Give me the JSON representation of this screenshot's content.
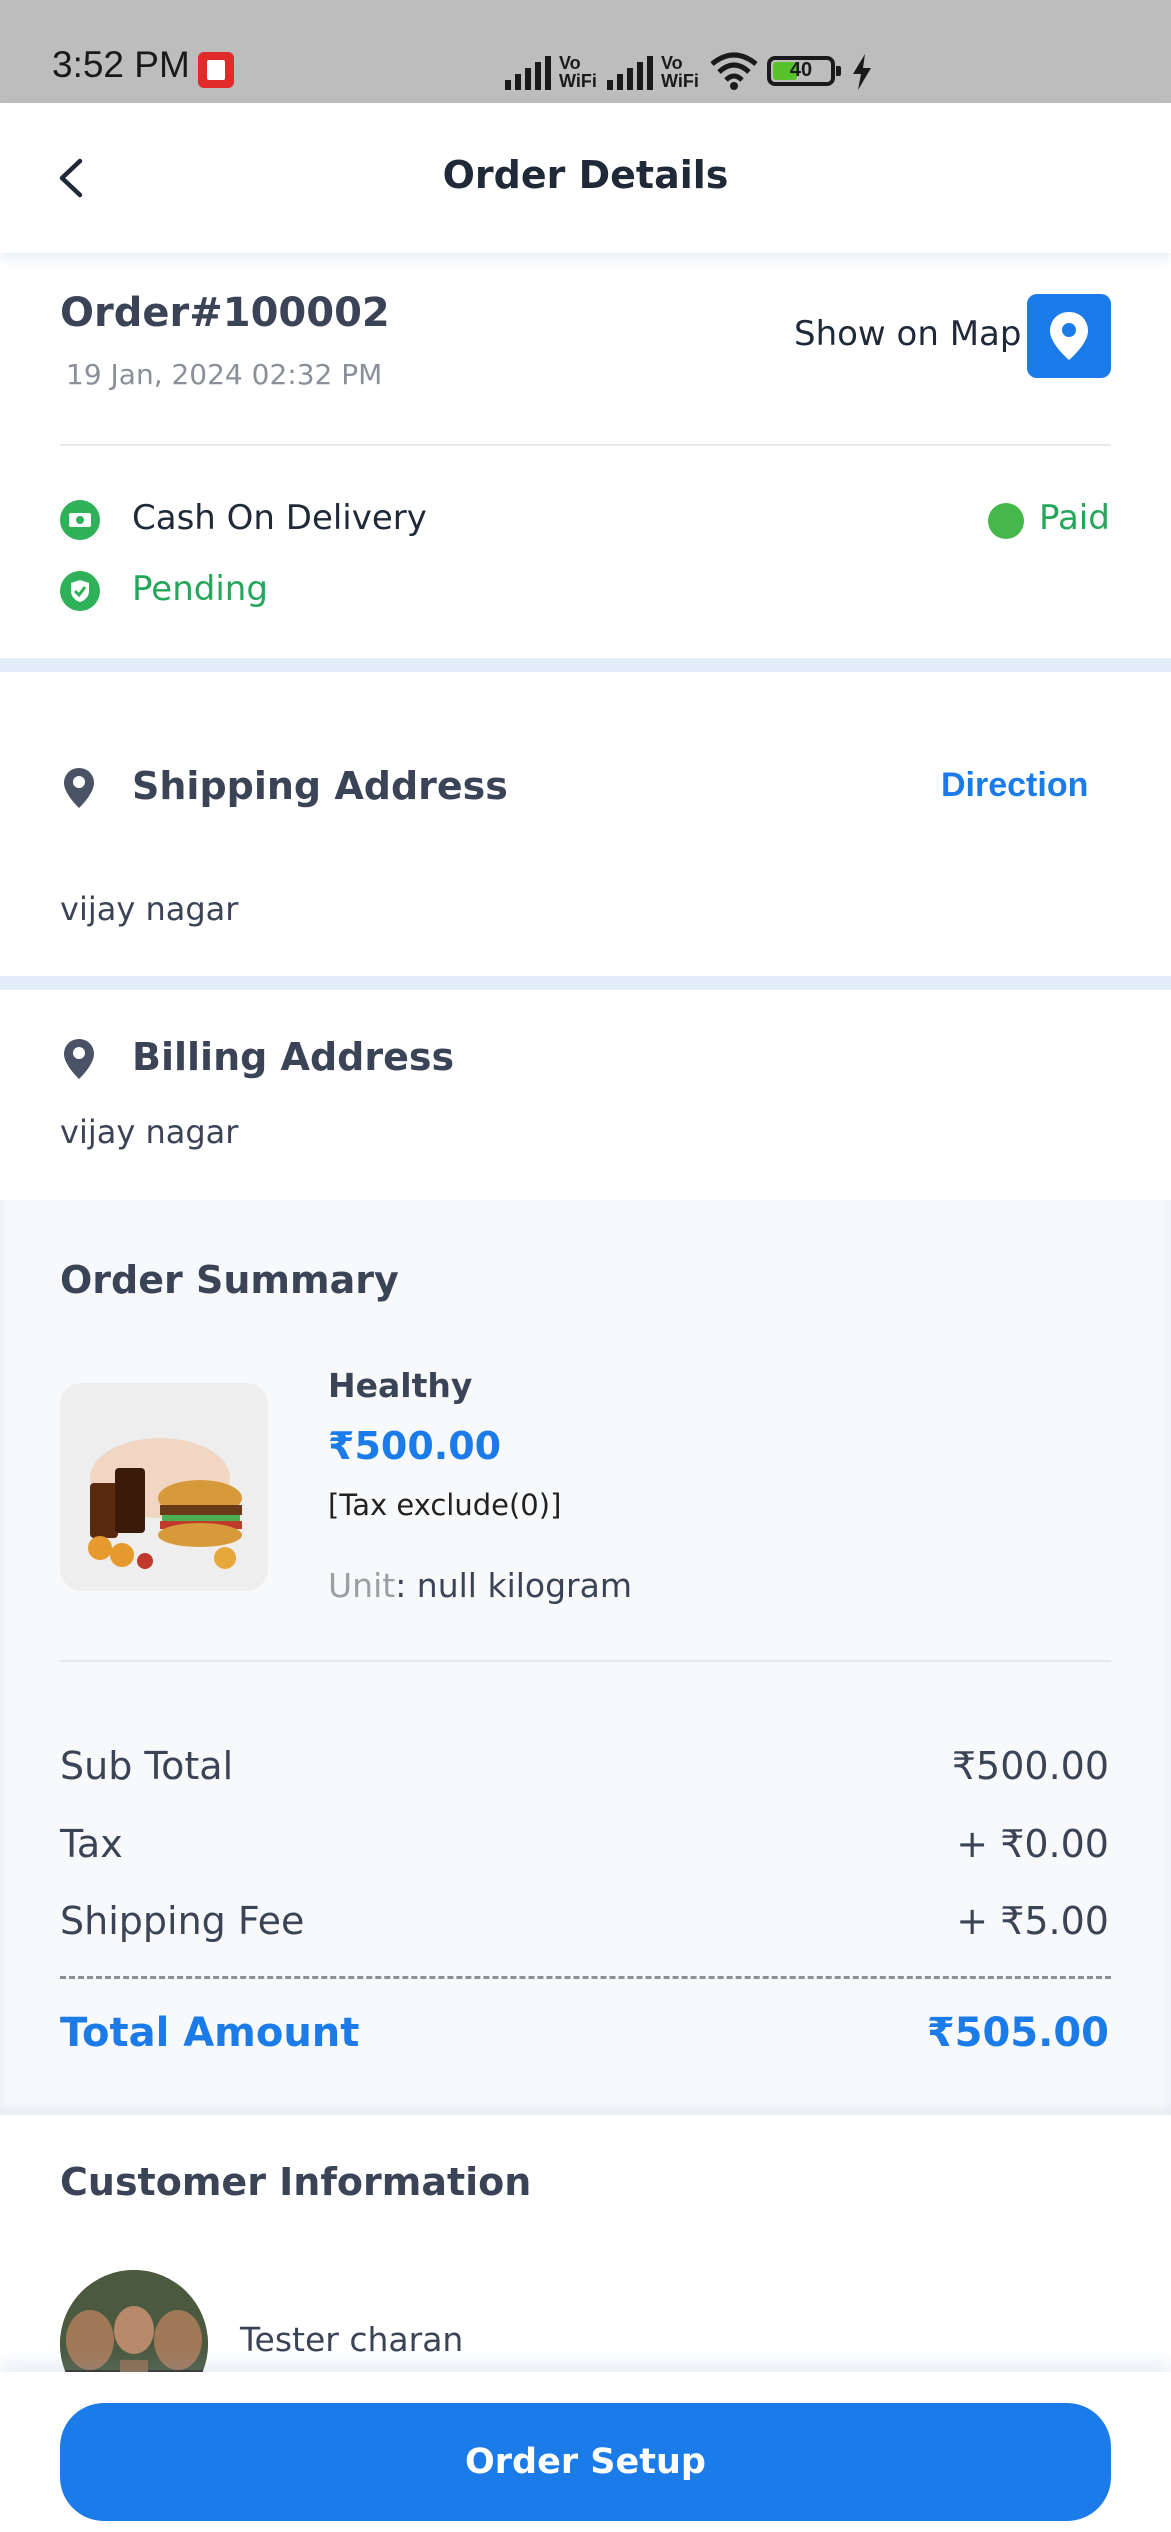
{
  "status_bar": {
    "time": "3:52 PM",
    "vowifi_1": "Vo WiFi",
    "vowifi_2": "Vo WiFi",
    "battery": "40"
  },
  "header": {
    "title": "Order Details"
  },
  "order": {
    "number": "Order#100002",
    "date": "19 Jan, 2024 02:32 PM",
    "show_on_map": "Show on Map",
    "payment_method": "Cash On Delivery",
    "payment_status": "Paid",
    "order_status": "Pending"
  },
  "shipping": {
    "title": "Shipping Address",
    "direction": "Direction",
    "address": "vijay nagar"
  },
  "billing": {
    "title": "Billing Address",
    "address": "vijay nagar"
  },
  "summary": {
    "title": "Order Summary",
    "item": {
      "name": "Healthy",
      "price": "₹500.00",
      "tax_note": "[Tax exclude(0)]",
      "unit_label": "Unit",
      "unit_value": ": null kilogram"
    },
    "sub_total_label": "Sub Total",
    "sub_total": "₹500.00",
    "tax_label": "Tax",
    "tax": "+ ₹0.00",
    "shipping_label": "Shipping Fee",
    "shipping": "+ ₹5.00",
    "total_label": "Total Amount",
    "total": "₹505.00"
  },
  "customer": {
    "title": "Customer Information",
    "name": "Tester charan"
  },
  "footer": {
    "order_setup": "Order Setup"
  },
  "colors": {
    "primary": "#1b7be8",
    "success": "#26a65b",
    "text": "#3b4457",
    "band": "#e3eefa"
  }
}
